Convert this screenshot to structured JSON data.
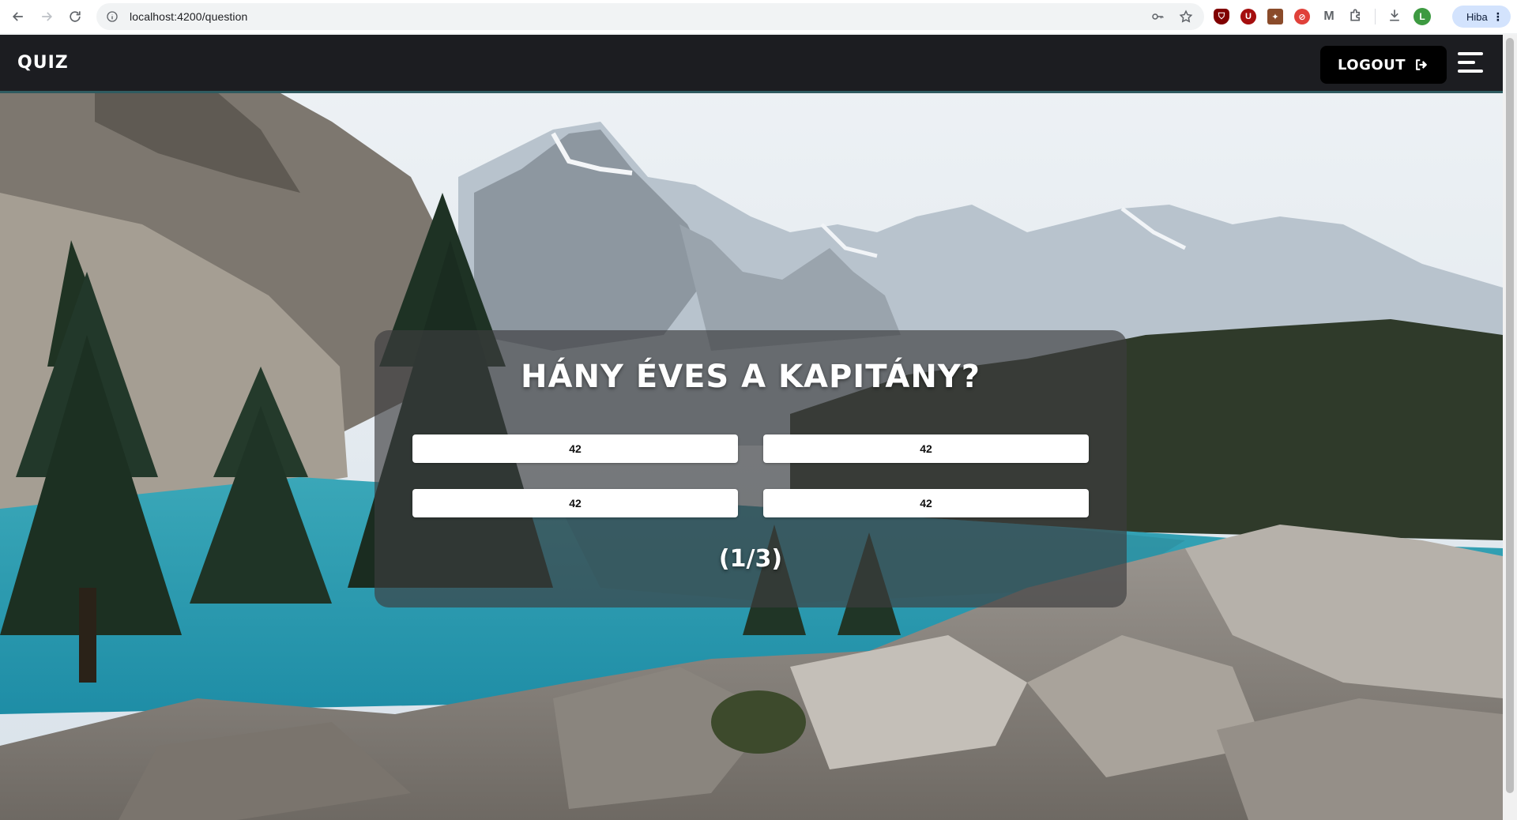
{
  "browser": {
    "url": "localhost:4200/question",
    "profile_initial": "L",
    "error_badge": "Hiba",
    "extensions": [
      {
        "name": "ublock-origin",
        "color": "#800000"
      },
      {
        "name": "ublock",
        "color": "#a50e0e",
        "label": "U"
      },
      {
        "name": "ext-brown",
        "color": "#8a4b2a"
      },
      {
        "name": "ext-red",
        "color": "#e0413a"
      },
      {
        "name": "ext-m",
        "color": "#5f6368"
      }
    ]
  },
  "navbar": {
    "brand": "QUIZ",
    "logout_label": "LOGOUT",
    "bg_color": "#1c1d21"
  },
  "quiz": {
    "question": "HÁNY ÉVES A KAPITÁNY?",
    "answers": [
      "42",
      "42",
      "42",
      "42"
    ],
    "progress": "(1/3)"
  },
  "theme": {
    "accent": "#2f5b60",
    "panel": "rgba(60,60,62,0.66)"
  }
}
